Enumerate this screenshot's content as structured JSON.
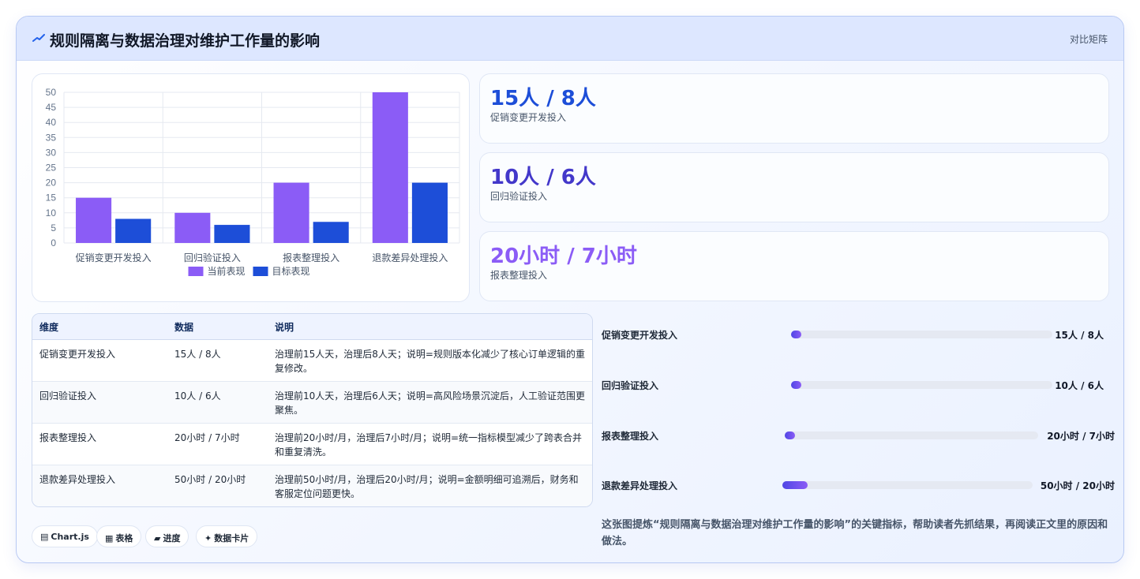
{
  "header": {
    "title": "规则隔离与数据治理对维护工作量的影响",
    "action": "对比矩阵",
    "icon": "chart-trend-icon"
  },
  "chart_data": {
    "type": "bar",
    "categories": [
      "促销变更开发投入",
      "回归验证投入",
      "报表整理投入",
      "退款差异处理投入"
    ],
    "series": [
      {
        "name": "当前表现",
        "values": [
          15,
          10,
          20,
          50
        ],
        "color": "#8b5cf6"
      },
      {
        "name": "目标表现",
        "values": [
          8,
          6,
          7,
          20
        ],
        "color": "#1d4ed8"
      }
    ],
    "yticks": [
      "0",
      "5",
      "10",
      "15",
      "20",
      "25",
      "30",
      "35",
      "40",
      "45",
      "50"
    ],
    "ylim": [
      0,
      50
    ],
    "grid": true,
    "legend": "bottom"
  },
  "stats": [
    {
      "value": "15人 / 8人",
      "label": "促销变更开发投入",
      "color": "#1d4ed8"
    },
    {
      "value": "10人 / 6人",
      "label": "回归验证投入",
      "color": "#4338ca"
    },
    {
      "value": "20小时 / 7小时",
      "label": "报表整理投入",
      "color": "#8b5cf6"
    }
  ],
  "table": {
    "headers": [
      "维度",
      "数据",
      "说明"
    ],
    "rows": [
      {
        "dim": "促销变更开发投入",
        "data": "15人 / 8人",
        "desc": "治理前15人天，治理后8人天；说明=规则版本化减少了核心订单逻辑的重复修改。"
      },
      {
        "dim": "回归验证投入",
        "data": "10人 / 6人",
        "desc": "治理前10人天，治理后6人天；说明=高风险场景沉淀后，人工验证范围更聚焦。"
      },
      {
        "dim": "报表整理投入",
        "data": "20小时 / 7小时",
        "desc": "治理前20小时/月，治理后7小时/月；说明=统一指标模型减少了跨表合并和重复清洗。"
      },
      {
        "dim": "退款差异处理投入",
        "data": "50小时 / 20小时",
        "desc": "治理前50小时/月，治理后20小时/月；说明=金额明细可追溯后，财务和客服定位问题更快。"
      }
    ]
  },
  "progress": [
    {
      "label": "促销变更开发投入",
      "value": "15人 / 8人",
      "fraction": 0.04
    },
    {
      "label": "回归验证投入",
      "value": "10人 / 6人",
      "fraction": 0.04
    },
    {
      "label": "报表整理投入",
      "value": "20小时 / 7小时",
      "fraction": 0.04
    },
    {
      "label": "退款差异处理投入",
      "value": "50小时 / 20小时",
      "fraction": 0.1
    }
  ],
  "tags": [
    {
      "icon": "▤",
      "label": "Chart.js"
    },
    {
      "icon": "▦",
      "label": "表格"
    },
    {
      "icon": "▰",
      "label": "进度"
    },
    {
      "icon": "✦",
      "label": "数据卡片"
    }
  ],
  "footer_note": "这张图提炼“规则隔离与数据治理对维护工作量的影响”的关键指标，帮助读者先抓结果，再阅读正文里的原因和做法。"
}
